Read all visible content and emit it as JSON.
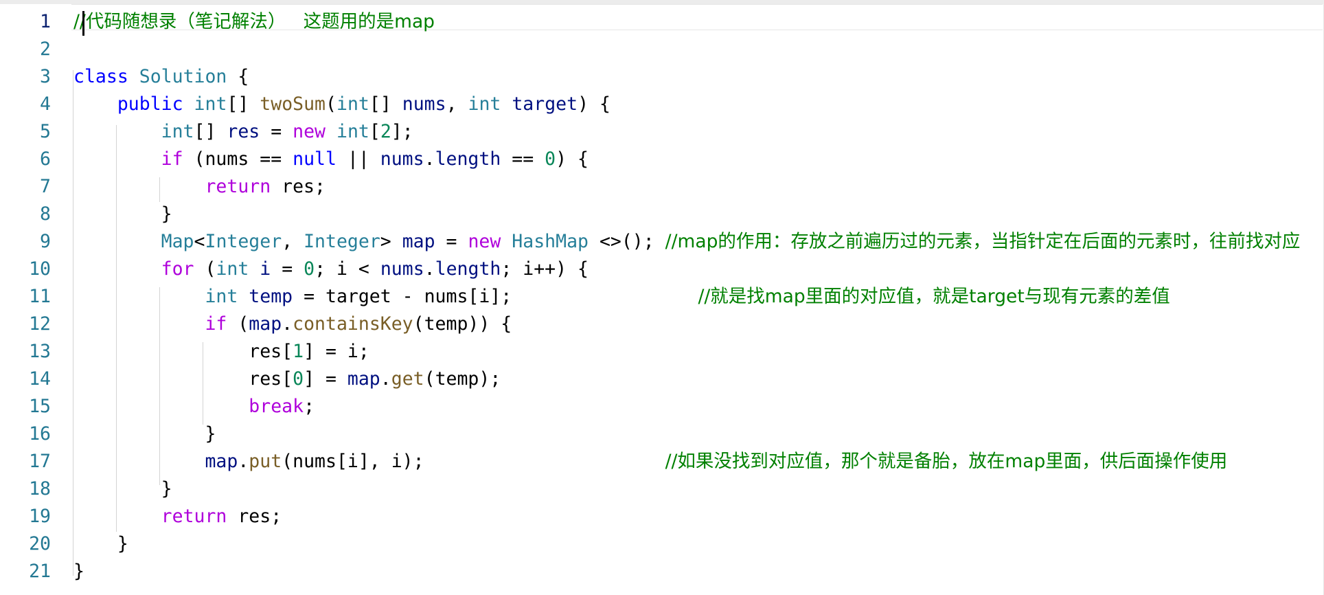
{
  "editor": {
    "lines": [
      {
        "n": "1",
        "tokens": [
          {
            "t": "//代码随想录（笔记解法）   这题用的是map",
            "s": "cm"
          }
        ]
      },
      {
        "n": "2",
        "tokens": []
      },
      {
        "n": "3",
        "tokens": [
          {
            "t": "class",
            "s": "k"
          },
          {
            "t": " ",
            "s": "p"
          },
          {
            "t": "Solution",
            "s": "t"
          },
          {
            "t": " {",
            "s": "p"
          }
        ]
      },
      {
        "n": "4",
        "tokens": [
          {
            "t": "    ",
            "s": "p"
          },
          {
            "t": "public",
            "s": "k"
          },
          {
            "t": " ",
            "s": "p"
          },
          {
            "t": "int",
            "s": "t"
          },
          {
            "t": "[] ",
            "s": "p"
          },
          {
            "t": "twoSum",
            "s": "f"
          },
          {
            "t": "(",
            "s": "p"
          },
          {
            "t": "int",
            "s": "t"
          },
          {
            "t": "[] ",
            "s": "p"
          },
          {
            "t": "nums",
            "s": "v"
          },
          {
            "t": ", ",
            "s": "p"
          },
          {
            "t": "int",
            "s": "t"
          },
          {
            "t": " ",
            "s": "p"
          },
          {
            "t": "target",
            "s": "v"
          },
          {
            "t": ") {",
            "s": "p"
          }
        ]
      },
      {
        "n": "5",
        "tokens": [
          {
            "t": "        ",
            "s": "p"
          },
          {
            "t": "int",
            "s": "t"
          },
          {
            "t": "[] ",
            "s": "p"
          },
          {
            "t": "res",
            "s": "v"
          },
          {
            "t": " = ",
            "s": "p"
          },
          {
            "t": "new",
            "s": "c"
          },
          {
            "t": " ",
            "s": "p"
          },
          {
            "t": "int",
            "s": "t"
          },
          {
            "t": "[",
            "s": "p"
          },
          {
            "t": "2",
            "s": "n"
          },
          {
            "t": "];",
            "s": "p"
          }
        ]
      },
      {
        "n": "6",
        "tokens": [
          {
            "t": "        ",
            "s": "p"
          },
          {
            "t": "if",
            "s": "c"
          },
          {
            "t": " (nums == ",
            "s": "p"
          },
          {
            "t": "null",
            "s": "k"
          },
          {
            "t": " || ",
            "s": "p"
          },
          {
            "t": "nums",
            "s": "v"
          },
          {
            "t": ".",
            "s": "p"
          },
          {
            "t": "length",
            "s": "v"
          },
          {
            "t": " == ",
            "s": "p"
          },
          {
            "t": "0",
            "s": "n"
          },
          {
            "t": ") {",
            "s": "p"
          }
        ]
      },
      {
        "n": "7",
        "tokens": [
          {
            "t": "            ",
            "s": "p"
          },
          {
            "t": "return",
            "s": "c"
          },
          {
            "t": " res;",
            "s": "p"
          }
        ]
      },
      {
        "n": "8",
        "tokens": [
          {
            "t": "        }",
            "s": "p"
          }
        ]
      },
      {
        "n": "9",
        "tokens": [
          {
            "t": "        ",
            "s": "p"
          },
          {
            "t": "Map",
            "s": "t"
          },
          {
            "t": "<",
            "s": "p"
          },
          {
            "t": "Integer",
            "s": "t"
          },
          {
            "t": ", ",
            "s": "p"
          },
          {
            "t": "Integer",
            "s": "t"
          },
          {
            "t": "> ",
            "s": "p"
          },
          {
            "t": "map",
            "s": "v"
          },
          {
            "t": " = ",
            "s": "p"
          },
          {
            "t": "new",
            "s": "c"
          },
          {
            "t": " ",
            "s": "p"
          },
          {
            "t": "HashMap",
            "s": "t"
          },
          {
            "t": " <>(); ",
            "s": "p"
          },
          {
            "t": "//map的作用：存放之前遍历过的元素，当指针定在后面的元素时，往前找对应",
            "s": "cm"
          }
        ]
      },
      {
        "n": "10",
        "tokens": [
          {
            "t": "        ",
            "s": "p"
          },
          {
            "t": "for",
            "s": "c"
          },
          {
            "t": " (",
            "s": "p"
          },
          {
            "t": "int",
            "s": "t"
          },
          {
            "t": " ",
            "s": "p"
          },
          {
            "t": "i",
            "s": "v"
          },
          {
            "t": " = ",
            "s": "p"
          },
          {
            "t": "0",
            "s": "n"
          },
          {
            "t": "; i < ",
            "s": "p"
          },
          {
            "t": "nums",
            "s": "v"
          },
          {
            "t": ".",
            "s": "p"
          },
          {
            "t": "length",
            "s": "v"
          },
          {
            "t": "; i++) {",
            "s": "p"
          }
        ]
      },
      {
        "n": "11",
        "tokens": [
          {
            "t": "            ",
            "s": "p"
          },
          {
            "t": "int",
            "s": "t"
          },
          {
            "t": " ",
            "s": "p"
          },
          {
            "t": "temp",
            "s": "v"
          },
          {
            "t": " = target - nums[i];                 ",
            "s": "p"
          },
          {
            "t": "//就是找map里面的对应值，就是target与现有元素的差值",
            "s": "cm"
          }
        ]
      },
      {
        "n": "12",
        "tokens": [
          {
            "t": "            ",
            "s": "p"
          },
          {
            "t": "if",
            "s": "c"
          },
          {
            "t": " (",
            "s": "p"
          },
          {
            "t": "map",
            "s": "v"
          },
          {
            "t": ".",
            "s": "p"
          },
          {
            "t": "containsKey",
            "s": "f"
          },
          {
            "t": "(temp)) {",
            "s": "p"
          }
        ]
      },
      {
        "n": "13",
        "tokens": [
          {
            "t": "                res[",
            "s": "p"
          },
          {
            "t": "1",
            "s": "n"
          },
          {
            "t": "] = i;",
            "s": "p"
          }
        ]
      },
      {
        "n": "14",
        "tokens": [
          {
            "t": "                res[",
            "s": "p"
          },
          {
            "t": "0",
            "s": "n"
          },
          {
            "t": "] = ",
            "s": "p"
          },
          {
            "t": "map",
            "s": "v"
          },
          {
            "t": ".",
            "s": "p"
          },
          {
            "t": "get",
            "s": "f"
          },
          {
            "t": "(temp);",
            "s": "p"
          }
        ]
      },
      {
        "n": "15",
        "tokens": [
          {
            "t": "                ",
            "s": "p"
          },
          {
            "t": "break",
            "s": "c"
          },
          {
            "t": ";",
            "s": "p"
          }
        ]
      },
      {
        "n": "16",
        "tokens": [
          {
            "t": "            }",
            "s": "p"
          }
        ]
      },
      {
        "n": "17",
        "tokens": [
          {
            "t": "            ",
            "s": "p"
          },
          {
            "t": "map",
            "s": "v"
          },
          {
            "t": ".",
            "s": "p"
          },
          {
            "t": "put",
            "s": "f"
          },
          {
            "t": "(nums[i], i);                      ",
            "s": "p"
          },
          {
            "t": "//如果没找到对应值，那个就是备胎，放在map里面，供后面操作使用",
            "s": "cm"
          }
        ]
      },
      {
        "n": "18",
        "tokens": [
          {
            "t": "        }",
            "s": "p"
          }
        ]
      },
      {
        "n": "19",
        "tokens": [
          {
            "t": "        ",
            "s": "p"
          },
          {
            "t": "return",
            "s": "c"
          },
          {
            "t": " res;",
            "s": "p"
          }
        ]
      },
      {
        "n": "20",
        "tokens": [
          {
            "t": "    }",
            "s": "p"
          }
        ]
      },
      {
        "n": "21",
        "tokens": [
          {
            "t": "}",
            "s": "p"
          }
        ]
      }
    ],
    "active_line": "1"
  }
}
